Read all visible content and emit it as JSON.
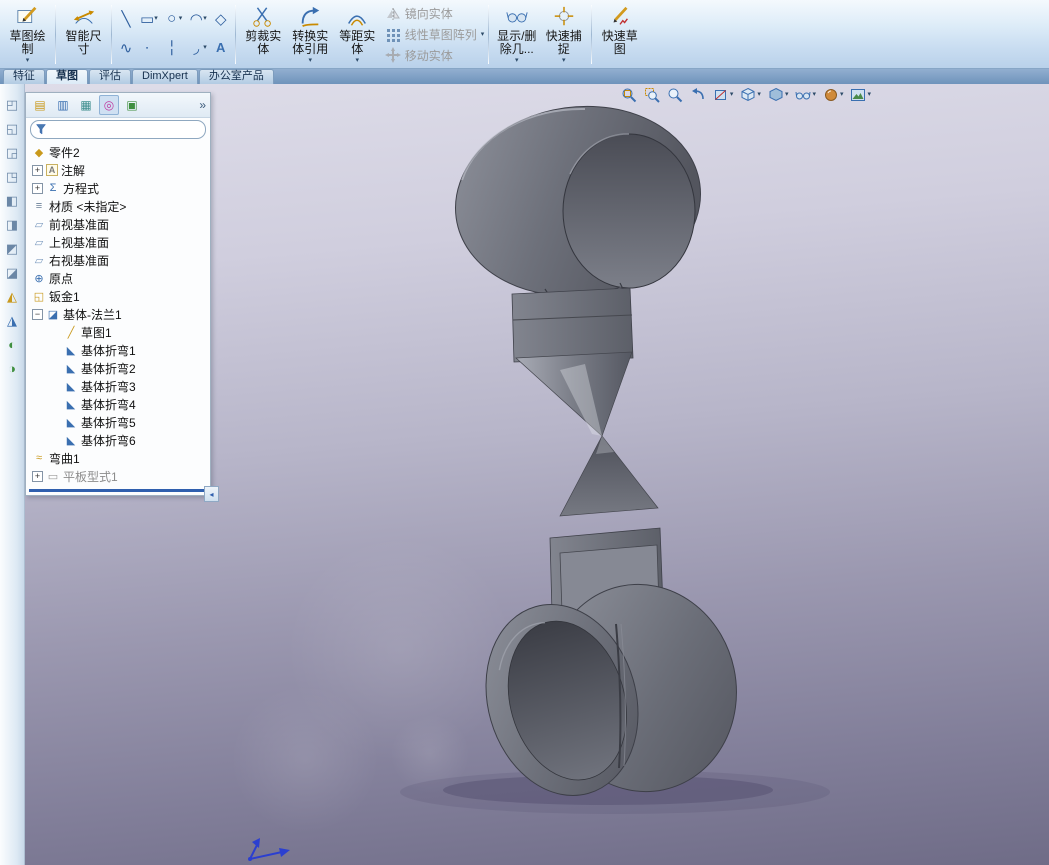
{
  "colors": {
    "accent": "#2f5fae",
    "part_gray": "#6b6e79",
    "viewport_top": "#dedde9",
    "viewport_bottom": "#6f6c87"
  },
  "ribbon": {
    "sketch_button": "草图绘制",
    "smart_dimension_button": "智能尺寸",
    "trim_button": "剪裁实体",
    "convert_button": "转换实体引用",
    "offset_button": "等距实体",
    "mirror_button": "镜向实体",
    "linear_pattern_button": "线性草图阵列",
    "move_button": "移动实体",
    "display_relations_button": "显示/删除几...",
    "quick_snap_button": "快速捕捉",
    "rapid_sketch_button": "快速草图",
    "tools": [
      {
        "name": "line",
        "glyph": "╲"
      },
      {
        "name": "rectangle",
        "glyph": "▭"
      },
      {
        "name": "circle",
        "glyph": "○"
      },
      {
        "name": "arc",
        "glyph": "◠"
      },
      {
        "name": "polygon",
        "glyph": "◇"
      },
      {
        "name": "spline",
        "glyph": "∿"
      },
      {
        "name": "point",
        "glyph": "∙"
      },
      {
        "name": "centerline",
        "glyph": "╎"
      },
      {
        "name": "fillet",
        "glyph": "◞"
      },
      {
        "name": "text",
        "glyph": "A"
      }
    ]
  },
  "tabs": {
    "items": [
      {
        "label": "特征"
      },
      {
        "label": "草图"
      },
      {
        "label": "评估"
      },
      {
        "label": "DimXpert"
      },
      {
        "label": "办公室产品"
      }
    ]
  },
  "feature_panel": {
    "filter_placeholder": "",
    "tree": {
      "items": [
        {
          "label": "零件2"
        },
        {
          "label": "注解",
          "expander": "+"
        },
        {
          "label": "方程式",
          "expander": "+"
        },
        {
          "label": "材质 <未指定>"
        },
        {
          "label": "前视基准面"
        },
        {
          "label": "上视基准面"
        },
        {
          "label": "右视基准面"
        },
        {
          "label": "原点"
        },
        {
          "label": "钣金1"
        },
        {
          "label": "基体-法兰1",
          "expander": "−"
        },
        {
          "label": "草图1"
        },
        {
          "label": "基体折弯1"
        },
        {
          "label": "基体折弯2"
        },
        {
          "label": "基体折弯3"
        },
        {
          "label": "基体折弯4"
        },
        {
          "label": "基体折弯5"
        },
        {
          "label": "基体折弯6"
        },
        {
          "label": "弯曲1"
        },
        {
          "label": "平板型式1",
          "expander": "+"
        }
      ]
    }
  },
  "icons": {
    "caret": "▾",
    "chevron": "»",
    "splitter": "◂",
    "part": "◆",
    "annotations": "A",
    "equations": "Σ",
    "material": "≡",
    "plane": "▱",
    "origin": "⊕",
    "sheet_metal": "◱",
    "base_flange": "◪",
    "sketch": "╱",
    "bend": "◣",
    "flex": "≈",
    "flat_pattern": "▭",
    "funnel": "▼",
    "left_strip": [
      "◰",
      "◱",
      "◲",
      "◳",
      "◧",
      "◨",
      "◩",
      "◪",
      "◭",
      "◮",
      "◐",
      "◑"
    ],
    "header": [
      "▤",
      "▥",
      "▦",
      "◎",
      "▣"
    ]
  }
}
